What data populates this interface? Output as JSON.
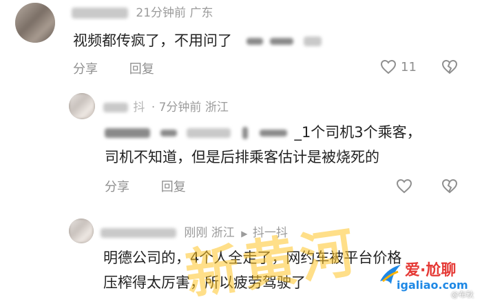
{
  "comments": [
    {
      "time_location": "21分钟前 广东",
      "text": "视频都传疯了，不用问了",
      "actions": {
        "share": "分享",
        "reply": "回复"
      },
      "likes": "11"
    },
    {
      "name_fragment": "抖",
      "time_location": "· 7分钟前 浙江",
      "text_line1": "_1个司机3个乘客，",
      "text_line2": "司机不知道，但是后排乘客估计是被烧死的",
      "actions": {
        "share": "分享",
        "reply": "回复"
      }
    },
    {
      "time_location": "刚刚 浙江",
      "source": "抖一抖",
      "text_line1": "明德公司的，4个人全走了，网约车被平台价格",
      "text_line2": "压榨得太厉害，所以疲劳驾驶了"
    }
  ],
  "watermarks": {
    "big": "新黄河",
    "logo_top": "爱·尬聊",
    "logo_bottom": "igaliao.com",
    "weibo": "@布秋"
  },
  "colors": {
    "meta": "#9b9b9b",
    "text": "#222222",
    "logo_red": "#e53935",
    "logo_blue": "#1e88e5",
    "watermark": "#ffc428"
  }
}
